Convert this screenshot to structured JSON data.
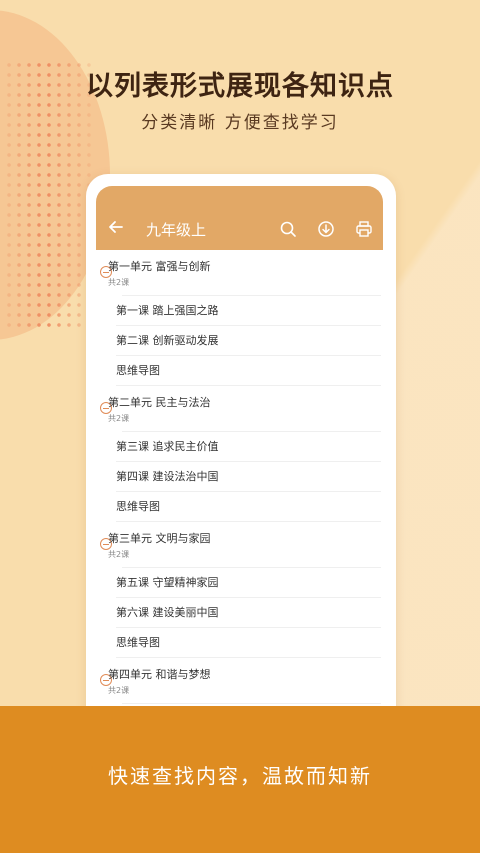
{
  "header": {
    "headline": "以列表形式展现各知识点",
    "subline": "分类清晰  方便查找学习"
  },
  "appbar": {
    "back_icon": "back-arrow-icon",
    "title": "九年级上",
    "icons": [
      "search-icon",
      "download-icon",
      "print-icon"
    ]
  },
  "units": [
    {
      "title": "第一单元  富强与创新",
      "count": "共2课",
      "lessons": [
        "第一课  踏上强国之路",
        "第二课  创新驱动发展",
        "思维导图"
      ]
    },
    {
      "title": "第二单元  民主与法治",
      "count": "共2课",
      "lessons": [
        "第三课  追求民主价值",
        "第四课  建设法治中国",
        "思维导图"
      ]
    },
    {
      "title": "第三单元  文明与家园",
      "count": "共2课",
      "lessons": [
        "第五课  守望精神家园",
        "第六课  建设美丽中国",
        "思维导图"
      ]
    },
    {
      "title": "第四单元  和谐与梦想",
      "count": "共2课",
      "lessons": []
    }
  ],
  "footer": {
    "tagline": "快速查找内容，温故而知新"
  },
  "colors": {
    "background": "#F9DDAC",
    "appbar": "#E2A866",
    "bottom_band": "#DE8C21",
    "accent": "#E08C58"
  }
}
